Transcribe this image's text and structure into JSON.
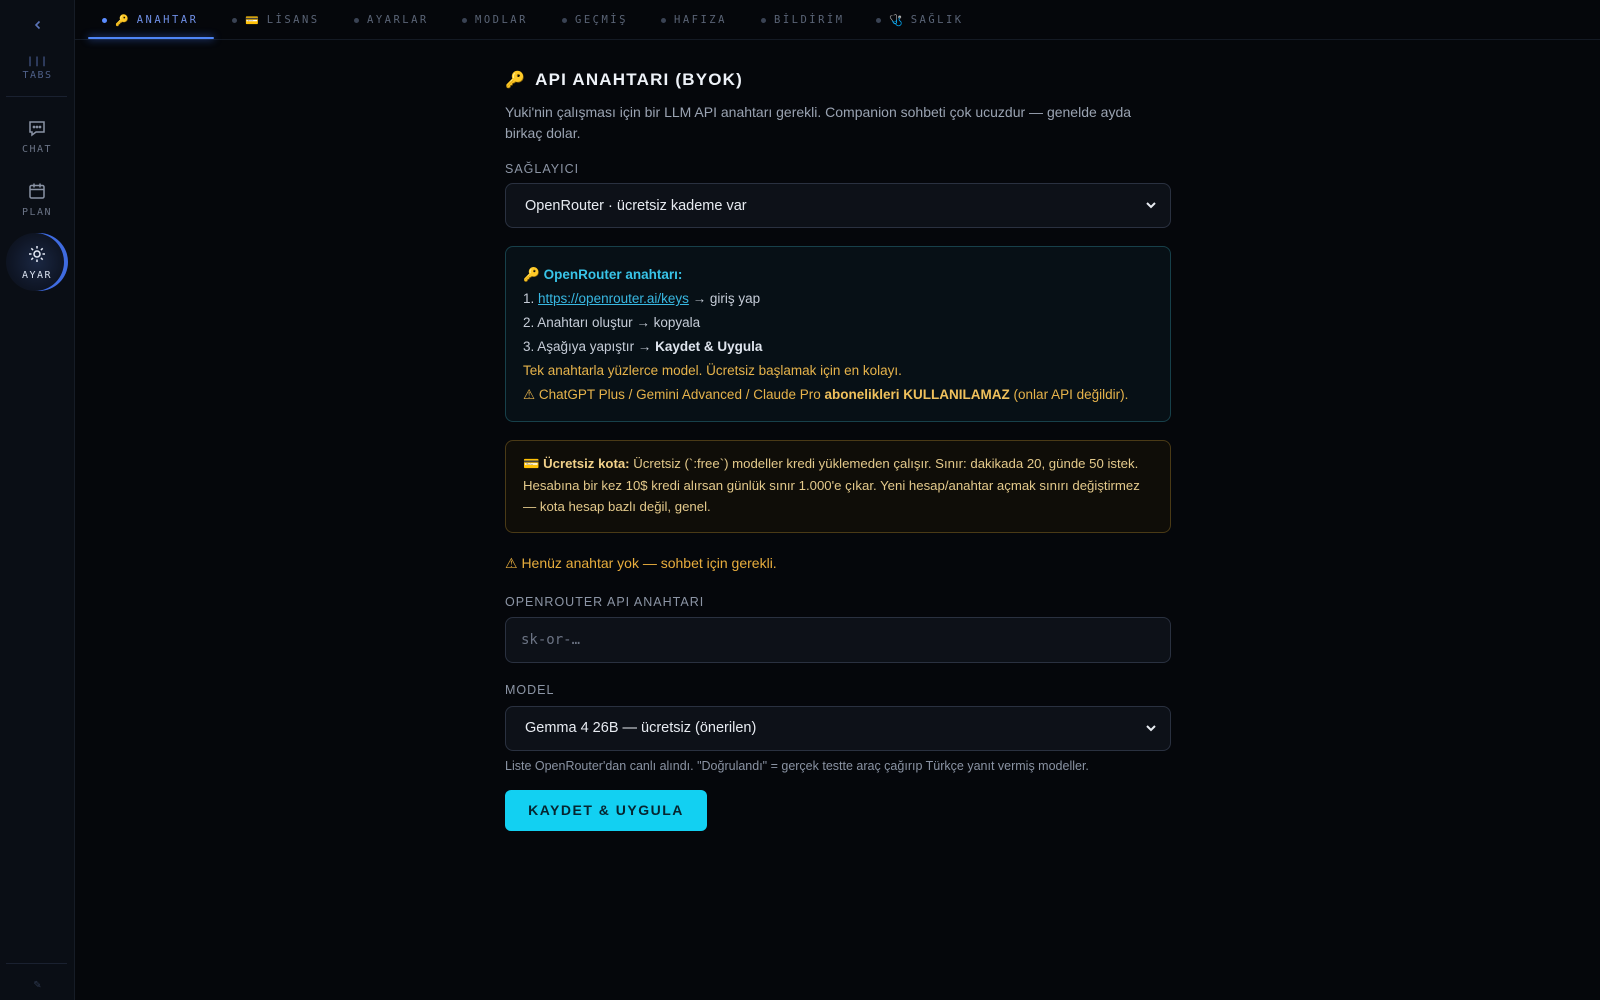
{
  "rail": {
    "tabs_label": "TABS",
    "items": [
      {
        "label": "CHAT",
        "icon": "chat-icon"
      },
      {
        "label": "PLAN",
        "icon": "calendar-icon"
      },
      {
        "label": "AYAR",
        "icon": "gear-icon",
        "active": true
      }
    ],
    "footer_glyph": "✎"
  },
  "tabs": [
    {
      "label": "ANAHTAR",
      "icon": "🔑",
      "active": true
    },
    {
      "label": "LİSANS",
      "icon": "💳"
    },
    {
      "label": "AYARLAR"
    },
    {
      "label": "MODLAR"
    },
    {
      "label": "GEÇMİŞ"
    },
    {
      "label": "HAFIZA"
    },
    {
      "label": "BİLDİRİM"
    },
    {
      "label": "SAĞLIK",
      "icon": "🩺"
    }
  ],
  "section": {
    "title_icon": "🔑",
    "title": "API ANAHTARI (BYOK)",
    "intro": "Yuki'nin çalışması için bir LLM API anahtarı gerekli. Companion sohbeti çok ucuzdur — genelde ayda birkaç dolar."
  },
  "provider": {
    "label": "SAĞLAYICI",
    "selected": "OpenRouter · ücretsiz kademe var"
  },
  "info": {
    "icon": "🔑",
    "heading": "OpenRouter anahtarı:",
    "step1_prefix": "1.",
    "step1_link": "https://openrouter.ai/keys",
    "step1_suffix": "→ giriş yap",
    "step2": "2. Anahtarı oluştur → kopyala",
    "step3_prefix": "3. Aşağıya yapıştır →",
    "step3_bold": "Kaydet & Uygula",
    "note": "Tek anahtarla yüzlerce model. Ücretsiz başlamak için en kolayı.",
    "warning_prefix": "⚠ ChatGPT Plus / Gemini Advanced / Claude Pro",
    "warning_bold": "abonelikleri KULLANILAMAZ",
    "warning_suffix": "(onlar API değildir)."
  },
  "quota": {
    "icon": "💳",
    "bold": "Ücretsiz kota:",
    "text": "Ücretsiz (`:free`) modeller kredi yüklemeden çalışır. Sınır: dakikada 20, günde 50 istek. Hesabına bir kez 10$ kredi alırsan günlük sınır 1.000'e çıkar. Yeni hesap/anahtar açmak sınırı değiştirmez — kota hesap bazlı değil, genel."
  },
  "status_warning": "⚠ Henüz anahtar yok — sohbet için gerekli.",
  "api_key": {
    "label": "OPENROUTER API ANAHTARI",
    "placeholder": "sk-or-…",
    "value": ""
  },
  "model": {
    "label": "MODEL",
    "selected": "Gemma 4 26B — ücretsiz (önerilen)",
    "hint": "Liste OpenRouter'dan canlı alındı. \"Doğrulandı\" = gerçek testte araç çağırıp Türkçe yanıt vermiş modeller."
  },
  "save_button": "KAYDET & UYGULA",
  "colors": {
    "accent": "#12d0f2",
    "tab_active": "#4f86f7",
    "warning": "#e8ad3d",
    "link": "#38b8e2"
  }
}
